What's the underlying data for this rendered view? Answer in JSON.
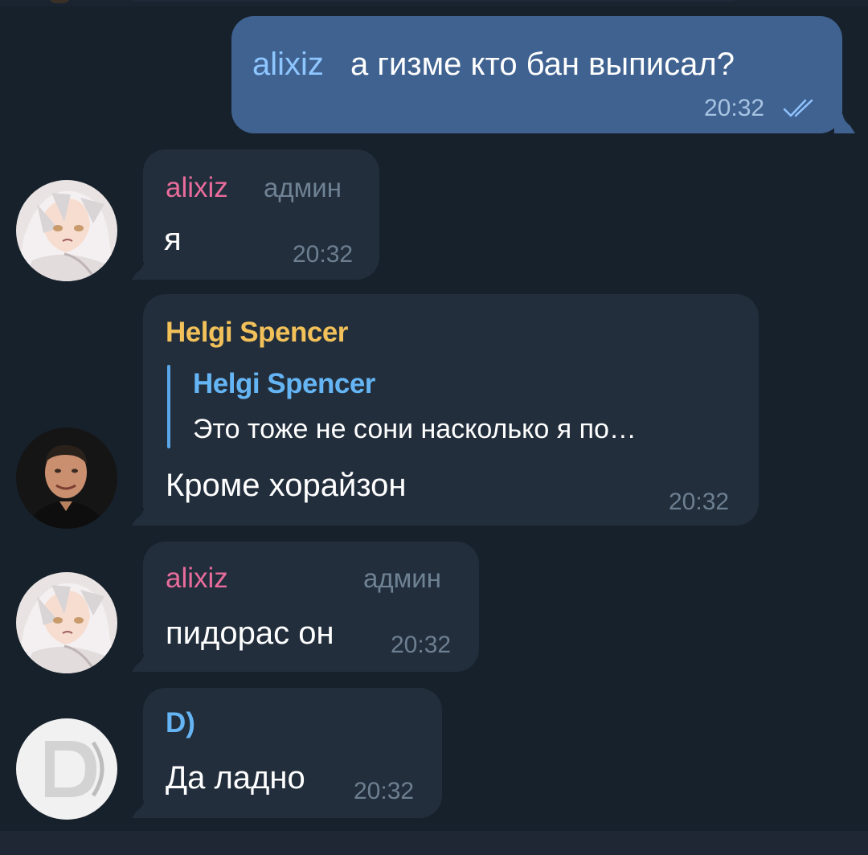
{
  "colors": {
    "background": "#17212b",
    "bubble_in": "#222e3c",
    "bubble_out": "#3f6290",
    "name_pink": "#e86c9b",
    "name_orange": "#f2c159",
    "name_blue": "#65b5f5",
    "time_in": "#6d7f91",
    "time_out": "#a8c4e3",
    "check": "#8fc3ff",
    "badge": "#6f8294"
  },
  "messages": [
    {
      "direction": "outgoing",
      "mention": "alixiz",
      "text": "а гизме кто бан выписал?",
      "time": "20:32",
      "status_icon": "double-check-icon"
    },
    {
      "direction": "incoming",
      "sender": "alixiz",
      "badge": "админ",
      "text": "я",
      "time": "20:32",
      "avatar": "anime-avatar"
    },
    {
      "direction": "incoming",
      "sender": "Helgi Spencer",
      "reply_to": {
        "sender": "Helgi Spencer",
        "text": "Это тоже не сони насколько я по…"
      },
      "text": "Кроме хорайзон",
      "time": "20:32",
      "avatar": "photo-avatar"
    },
    {
      "direction": "incoming",
      "sender": "alixiz",
      "badge": "админ",
      "text": "пидорас он",
      "time": "20:32",
      "avatar": "anime-avatar"
    },
    {
      "direction": "incoming",
      "sender": "D)",
      "text": "Да ладно",
      "time": "20:32",
      "avatar": "letter-d-avatar"
    }
  ]
}
